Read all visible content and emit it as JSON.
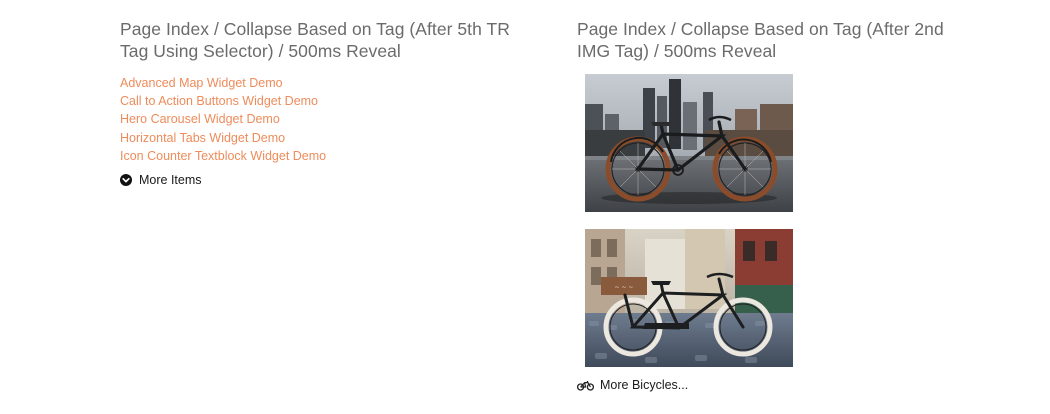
{
  "left": {
    "heading": "Page Index / Collapse Based on Tag (After 5th TR Tag Using Selector) / 500ms Reveal",
    "links": [
      "Advanced Map Widget Demo",
      "Call to Action Buttons Widget Demo",
      "Hero Carousel Widget Demo",
      "Horizontal Tabs Widget Demo",
      "Icon Counter Textblock Widget Demo"
    ],
    "toggle_label": "More Items",
    "toggle_icon": "chevron-circle-down-icon"
  },
  "right": {
    "heading": "Page Index / Collapse Based on Tag (After 2nd IMG Tag) / 500ms Reveal",
    "images": [
      {
        "name": "bicycle-city-photo",
        "description": "Vintage bicycle with brown tires parked in front of a city skyline"
      },
      {
        "name": "bicycle-cobblestone-photo",
        "description": "Black bicycle with white tires and wooden crate on a cobblestone street"
      }
    ],
    "toggle_label": "More Bicycles...",
    "toggle_icon": "bicycle-icon"
  },
  "colors": {
    "link": "#ee8c5b",
    "heading": "#6b6b6b",
    "text": "#1a1a1a"
  }
}
